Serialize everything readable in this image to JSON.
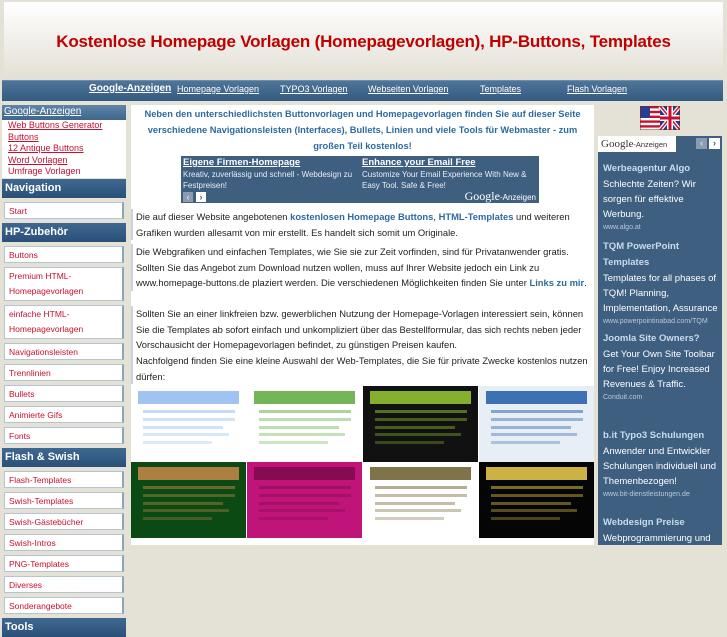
{
  "header": {
    "title": "Kostenlose Homepage Vorlagen (Homepagevorlagen), HP-Buttons, Templates"
  },
  "topnav": {
    "items": [
      {
        "label": "Google-Anzeigen"
      },
      {
        "label": "Homepage Vorlagen"
      },
      {
        "label": "TYPO3 Vorlagen"
      },
      {
        "label": "Webseiten Vorlagen"
      },
      {
        "label": "Templates"
      },
      {
        "label": "Flash Vorlagen"
      }
    ]
  },
  "left_ads": {
    "title": "Google-Anzeigen",
    "links": [
      "Web Buttons Generator",
      "Buttons",
      "12 Antique Buttons",
      "Word Vorlagen",
      "Umfrage Vorlagen"
    ]
  },
  "sidebar": {
    "sections": [
      {
        "title": "Navigation",
        "items": [
          "Start"
        ]
      },
      {
        "title": "HP-Zubehör",
        "items": [
          "Buttons",
          "Premium HTML-Homepagevorlagen",
          "einfache HTML-Homepagevorlagen",
          "Navigationsleisten",
          "Trennlinien",
          "Bullets",
          "Animierte Gifs",
          "Fonts"
        ]
      },
      {
        "title": "Flash & Swish",
        "items": [
          "Flash-Templates",
          "Swish-Templates",
          "Swish-Gästebücher",
          "Swish-Intros",
          "PNG-Templates",
          "Diverses",
          "Sonderangebote"
        ]
      },
      {
        "title": "Tools",
        "items": []
      }
    ]
  },
  "main": {
    "intro": "Neben den unterschiedlichsten Buttonvorlagen und Homepagevorlagen finden Sie auf dieser Seite verschiedene Navigationsleisten (Interfaces), Bullets, Linien und viele Tools für Webmaster - zum großen Teil kostenlos!",
    "banner": {
      "ads": [
        {
          "title": "Eigene Firmen-Homepage",
          "desc": "Kreativ, zuverlässig und schnell - Webdesign zu Festpreisen!"
        },
        {
          "title": "Enhance your Email Free",
          "desc": "Customize Your Email Experience With New & Easy Tool. Safe & Free!"
        }
      ],
      "google": "Google",
      "google_suffix": "-Anzeigen",
      "prev_icon": "‹",
      "next_icon": "›"
    },
    "p1": {
      "pre": "Die auf dieser Website angebotenen ",
      "link1": "kostenlosen Homepage Buttons",
      "mid": ", ",
      "link2": "HTML-Templates",
      "post": " und weiteren Grafiken wurden allesamt von mir erstellt. Es handelt sich somit um Originale."
    },
    "p2": {
      "pre": "Die Webgrafiken und einfachen Templates, wie Sie sie zur Zeit vorfinden, sind für Privatanwender gratis. Sollten Sie das Angebot zum Download nutzen wollen, muss auf Ihrer Website jedoch ein Link zu www.homepage-buttons.de plaziert werden. Die verschiedenen Möglichkeiten finden Sie unter ",
      "link": "Links zu mir",
      "post": "."
    },
    "p3": "Sollten Sie an einer linkfreien bzw. gewerblichen Nutzung der Homepage-Vorlagen interessiert sein, können Sie die Templates ab sofort einfach und unkompliziert über das Bestellformular, das sich rechts neben jeder Vorschausicht der Homepagevorlagen befindet, zu günstigen Preisen kaufen.",
    "p4": "Nachfolgend finden Sie eine kleine Auswahl der Web-Templates, die Sie für private Zwecke kostenlos nutzen dürfen:",
    "thumbnails": [
      {
        "name": "template-blue-light",
        "colors": [
          "#ffffff",
          "#8fb8ef"
        ]
      },
      {
        "name": "template-butterflies",
        "colors": [
          "#ffffff",
          "#5aa83a"
        ]
      },
      {
        "name": "template-green-black",
        "colors": [
          "#111111",
          "#9acd32"
        ]
      },
      {
        "name": "template-blue-frame",
        "colors": [
          "#e8eef6",
          "#1e5aa8"
        ]
      },
      {
        "name": "template-dark-green",
        "colors": [
          "#0b4a12",
          "#c98a4a"
        ]
      },
      {
        "name": "template-magenta",
        "colors": [
          "#c0147a",
          "#7a0b4a"
        ]
      },
      {
        "name": "template-forest",
        "colors": [
          "#ffffff",
          "#6a5a2a"
        ]
      },
      {
        "name": "template-black-gold",
        "colors": [
          "#050505",
          "#f0d050"
        ]
      }
    ]
  },
  "right": {
    "flag_icon": "us-uk-flag-icon",
    "ads_logo": "Google",
    "ads_logo_suffix": "-Anzeigen",
    "prev_icon": "‹",
    "next_icon": "›",
    "ads": [
      {
        "title": "Werbeagentur Algo",
        "desc": "Schlechte Zeiten? Wir sorgen für effektive Werbung.",
        "url": "www.algo.at"
      },
      {
        "title": "TQM PowerPoint Templates",
        "desc": "Templates for all phases of TQM! Planning, Implementation, Assurance",
        "url": "www.powerpointinabad.com/TQM"
      },
      {
        "title": "Joomla Site Owners?",
        "desc": "Get Your Own Site Toolbar for Free! Enjoy Increased Revenues & Traffic.",
        "url": "Conduit.com"
      },
      {
        "title": "b.it Typo3 Schulungen",
        "desc": "Anwender und Entwickler Schulungen individuell und Themenbezogen!",
        "url": "www.bit-dienstleistungen.de"
      },
      {
        "title": "Webdesign Preise",
        "desc": "Webprogrammierung und",
        "url": ""
      }
    ]
  }
}
